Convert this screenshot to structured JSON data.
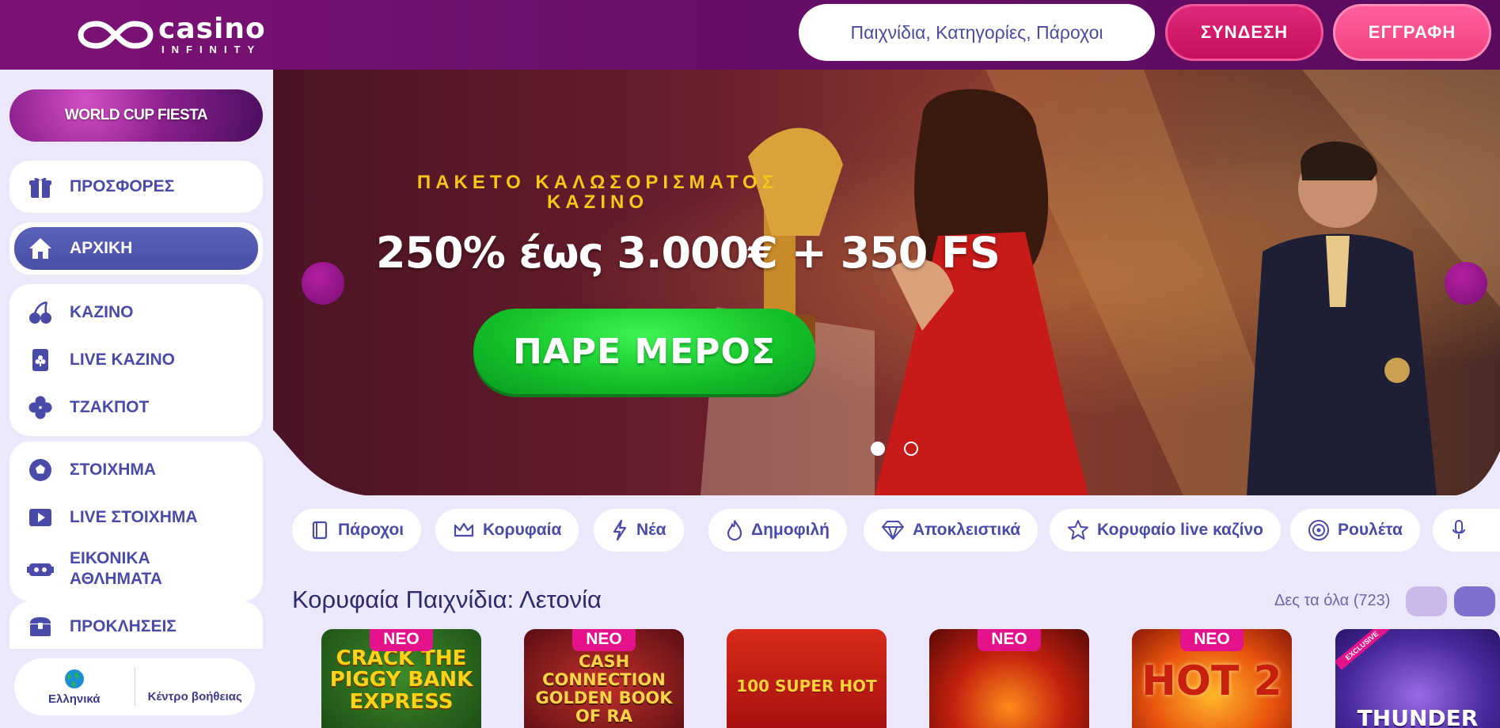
{
  "header": {
    "logo_line1": "casino",
    "logo_line2": "INFINITY",
    "search_placeholder": "Παιχνίδια, Κατηγορίες, Πάροχοι",
    "login_label": "ΣΥΝΔΕΣΗ",
    "register_label": "ΕΓΓΡΑΦΗ"
  },
  "sidebar": {
    "promo_label": "WORLD CUP FIESTA",
    "items": [
      {
        "label": "ΠΡΟΣΦΟΡΕΣ",
        "icon": "gift-icon"
      },
      {
        "label": "ΑΡΧΙΚΗ",
        "icon": "home-icon",
        "active": true
      },
      {
        "label": "ΚΑΖΙΝΟ",
        "icon": "cherry-icon"
      },
      {
        "label": "LIVE ΚΑΖΙΝΟ",
        "icon": "card-icon"
      },
      {
        "label": "ΤΖΑΚΠΟΤ",
        "icon": "clover-icon"
      },
      {
        "label": "ΣΤΟΙΧΗΜΑ",
        "icon": "soccer-ball-icon"
      },
      {
        "label": "LIVE ΣΤΟΙΧΗΜΑ",
        "icon": "play-icon"
      },
      {
        "label": "ΕΙΚΟΝΙΚΑ ΑΘΛΗΜΑΤΑ",
        "icon": "vr-headset-icon"
      },
      {
        "label": "ΠΡΟΚΛΗΣΕΙΣ",
        "icon": "chest-icon"
      }
    ],
    "language_label": "Ελληνικά",
    "help_label": "Κέντρο βοήθειας"
  },
  "hero": {
    "subtitle_line1": "ΠΑΚΕΤΟ ΚΑΛΩΣΟΡΙΣΜΑΤΟΣ",
    "subtitle_line2": "ΚΑΖΙΝΟ",
    "title": "250% έως 3.000€ + 350 FS",
    "cta_label": "ΠΑΡΕ ΜΕΡΟΣ",
    "slides_total": 2,
    "slide_active": 1
  },
  "categories": [
    {
      "label": "Πάροχοι",
      "icon": "book-icon"
    },
    {
      "label": "Κορυφαία",
      "icon": "crown-icon"
    },
    {
      "label": "Νέα",
      "icon": "lightning-icon"
    },
    {
      "label": "Δημοφιλή",
      "icon": "flame-icon"
    },
    {
      "label": "Αποκλειστικά",
      "icon": "diamond-icon"
    },
    {
      "label": "Κορυφαίο live καζίνο",
      "icon": "star-icon"
    },
    {
      "label": "Ρουλέτα",
      "icon": "roulette-icon"
    },
    {
      "label": "",
      "icon": "microphone-icon"
    }
  ],
  "section": {
    "title": "Κορυφαία Παιχνίδια: Λετονία",
    "see_all_label": "Δες τα όλα (723)"
  },
  "games": [
    {
      "title": "CRACK THE PIGGY BANK EXPRESS",
      "badge": "ΝΕΟ"
    },
    {
      "title": "CASH CONNECTION GOLDEN BOOK OF RA",
      "badge": "ΝΕΟ"
    },
    {
      "title": "100 SUPER HOT",
      "badge": ""
    },
    {
      "title": "",
      "badge": "ΝΕΟ"
    },
    {
      "title": "HOT 2",
      "badge": "ΝΕΟ"
    },
    {
      "title": "THUNDER",
      "badge": "EXCLUSIVE"
    }
  ],
  "colors": {
    "header_purple": "#6a0f6a",
    "login_pink": "#c4105c",
    "register_pink": "#f0407f",
    "nav_active": "#4a4fa6",
    "cta_green": "#14c42a",
    "hero_gold": "#f7c61a",
    "badge_new": "#e4138b"
  }
}
